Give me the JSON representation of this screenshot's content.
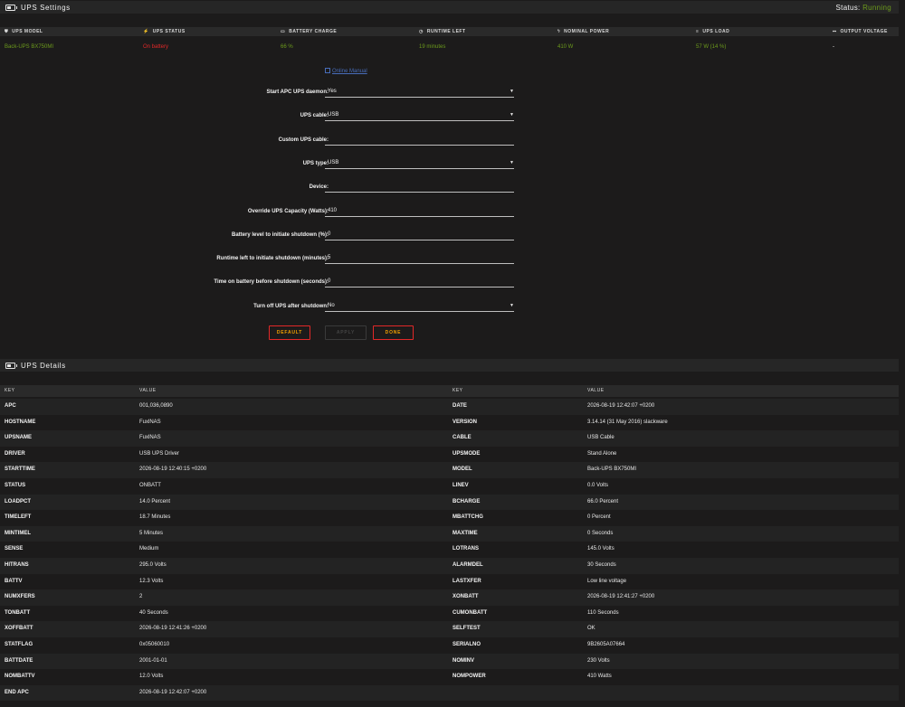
{
  "settings_bar": {
    "title": "UPS Settings",
    "status_label": "Status:",
    "status_value": "Running"
  },
  "summary": {
    "headers": [
      {
        "icon": "shield-icon",
        "glyph": "⛊",
        "label": "UPS MODEL"
      },
      {
        "icon": "plug-icon",
        "glyph": "⚡",
        "label": "UPS STATUS"
      },
      {
        "icon": "battery-icon",
        "glyph": "▭",
        "label": "BATTERY CHARGE"
      },
      {
        "icon": "clock-icon",
        "glyph": "◷",
        "label": "RUNTIME LEFT"
      },
      {
        "icon": "bolt-icon",
        "glyph": "ϟ",
        "label": "NOMINAL POWER"
      },
      {
        "icon": "list-icon",
        "glyph": "≡",
        "label": "UPS LOAD"
      },
      {
        "icon": "output-icon",
        "glyph": "⎓",
        "label": "OUTPUT VOLTAGE"
      }
    ],
    "values": [
      {
        "text": "Back-UPS BX750MI",
        "tone": "green"
      },
      {
        "text": "On battery",
        "tone": "red"
      },
      {
        "text": "66 %",
        "tone": "green"
      },
      {
        "text": "19 minutes",
        "tone": "green"
      },
      {
        "text": "410 W",
        "tone": "green"
      },
      {
        "text": "57 W (14 %)",
        "tone": "green"
      },
      {
        "text": "-",
        "tone": "white"
      }
    ]
  },
  "manual_link": "Online Manual",
  "form": [
    {
      "label": "Start APC UPS daemon:",
      "value": "Yes",
      "select": true
    },
    {
      "label": "UPS cable:",
      "value": "USB",
      "select": true
    },
    {
      "label": "Custom UPS cable:",
      "value": "",
      "select": false
    },
    {
      "label": "UPS type:",
      "value": "USB",
      "select": true
    },
    {
      "label": "Device:",
      "value": "",
      "select": false
    },
    {
      "label": "Override UPS Capacity (Watts):",
      "value": "410",
      "select": false
    },
    {
      "label": "Battery level to initiate shutdown (%):",
      "value": "0",
      "select": false
    },
    {
      "label": "Runtime left to initiate shutdown (minutes):",
      "value": "5",
      "select": false
    },
    {
      "label": "Time on battery before shutdown (seconds):",
      "value": "0",
      "select": false
    },
    {
      "label": "Turn off UPS after shutdown:",
      "value": "No",
      "select": true
    }
  ],
  "buttons": {
    "default": "DEFAULT",
    "apply": "APPLY",
    "done": "DONE"
  },
  "details_bar": {
    "title": "UPS Details"
  },
  "details": {
    "headers": [
      "KEY",
      "VALUE",
      "KEY",
      "VALUE"
    ],
    "rows": [
      [
        "APC",
        "001,036,0890",
        "DATE",
        "2026-08-19 12:42:07 +0200"
      ],
      [
        "HOSTNAME",
        "FuxlNAS",
        "VERSION",
        "3.14.14 (31 May 2016) slackware"
      ],
      [
        "UPSNAME",
        "FuxlNAS",
        "CABLE",
        "USB Cable"
      ],
      [
        "DRIVER",
        "USB UPS Driver",
        "UPSMODE",
        "Stand Alone"
      ],
      [
        "STARTTIME",
        "2026-08-19 12:40:15 +0200",
        "MODEL",
        "Back-UPS BX750MI"
      ],
      [
        "STATUS",
        "ONBATT",
        "LINEV",
        "0.0 Volts"
      ],
      [
        "LOADPCT",
        "14.0 Percent",
        "BCHARGE",
        "66.0 Percent"
      ],
      [
        "TIMELEFT",
        "18.7 Minutes",
        "MBATTCHG",
        "0 Percent"
      ],
      [
        "MINTIMEL",
        "5 Minutes",
        "MAXTIME",
        "0 Seconds"
      ],
      [
        "SENSE",
        "Medium",
        "LOTRANS",
        "145.0 Volts"
      ],
      [
        "HITRANS",
        "295.0 Volts",
        "ALARMDEL",
        "30 Seconds"
      ],
      [
        "BATTV",
        "12.3 Volts",
        "LASTXFER",
        "Low line voltage"
      ],
      [
        "NUMXFERS",
        "2",
        "XONBATT",
        "2026-08-19 12:41:27 +0200"
      ],
      [
        "TONBATT",
        "40 Seconds",
        "CUMONBATT",
        "110 Seconds"
      ],
      [
        "XOFFBATT",
        "2026-08-19 12:41:26 +0200",
        "SELFTEST",
        "OK"
      ],
      [
        "STATFLAG",
        "0x05060010",
        "SERIALNO",
        "9B2605A07664"
      ],
      [
        "BATTDATE",
        "2001-01-01",
        "NOMINV",
        "230 Volts"
      ],
      [
        "NOMBATTV",
        "12.0 Volts",
        "NOMPOWER",
        "410 Watts"
      ],
      [
        "END APC",
        "2026-08-19 12:42:07 +0200",
        "",
        ""
      ]
    ]
  },
  "colors": {
    "accent_green": "#6c9b1c",
    "alert_red": "#e22828",
    "button_text": "#f0a000",
    "link": "#486dba"
  }
}
